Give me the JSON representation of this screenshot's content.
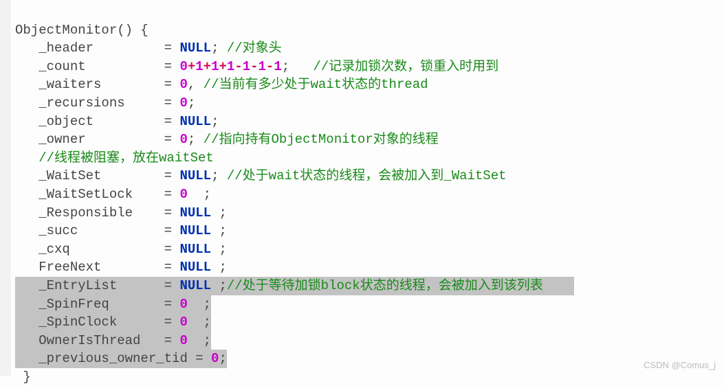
{
  "code": {
    "fn_decl": "ObjectMonitor() {",
    "header_lhs": "   _header         = ",
    "header_null": "NULL",
    "header_semi": "; ",
    "header_cmt": "//对象头",
    "count_lhs": "   _count          = ",
    "count_n0": "0",
    "count_p1": "+",
    "count_n1": "1",
    "count_p2": "+",
    "count_n2": "1",
    "count_p3": "+",
    "count_n3": "1",
    "count_m1": "-",
    "count_n4": "1",
    "count_m2": "-",
    "count_n5": "1",
    "count_m3": "-",
    "count_n6": "1",
    "count_semi": ";   ",
    "count_cmt": "//记录加锁次数，锁重入时用到",
    "waiters_lhs": "   _waiters        = ",
    "waiters_n": "0",
    "waiters_comma": ", ",
    "waiters_cmt": "//当前有多少处于wait状态的thread",
    "recursions_lhs": "   _recursions     = ",
    "recursions_n": "0",
    "recursions_semi": ";",
    "object_lhs": "   _object         = ",
    "object_null": "NULL",
    "object_semi": ";",
    "owner_lhs": "   _owner          = ",
    "owner_n": "0",
    "owner_semi": "; ",
    "owner_cmt": "//指向持有ObjectMonitor对象的线程",
    "block_cmt": "   //线程被阻塞，放在waitSet",
    "waitset_lhs": "   _WaitSet        = ",
    "waitset_null": "NULL",
    "waitset_semi": "; ",
    "waitset_cmt": "//处于wait状态的线程，会被加入到_WaitSet",
    "wslock_lhs": "   _WaitSetLock    = ",
    "wslock_n": "0",
    "wslock_semi": "  ;",
    "responsible_lhs": "   _Responsible    = ",
    "responsible_null": "NULL",
    "responsible_semi": " ;",
    "succ_lhs": "   _succ           = ",
    "succ_null": "NULL",
    "succ_semi": " ;",
    "cxq_lhs": "   _cxq            = ",
    "cxq_null": "NULL",
    "cxq_semi": " ;",
    "freenext_lhs": "   FreeNext        = ",
    "freenext_null": "NULL",
    "freenext_semi": " ;",
    "entrylist_lhs": "   _EntryList      = ",
    "entrylist_null": "NULL",
    "entrylist_semi": " ;",
    "entrylist_cmt": "//处于等待加锁block状态的线程，会被加入到该列表",
    "entrylist_pad": "    ",
    "spinfreq_lhs": "   _SpinFreq       = ",
    "spinfreq_n": "0",
    "spinfreq_semi": "  ;",
    "spinclock_lhs": "   _SpinClock      = ",
    "spinclock_n": "0",
    "spinclock_semi": "  ;",
    "ownerthread_lhs": "   OwnerIsThread   = ",
    "ownerthread_n": "0",
    "ownerthread_semi": "  ;",
    "prevtid_lhs": "   _previous_owner_tid = ",
    "prevtid_n": "0",
    "prevtid_semi": ";",
    "close_brace": " }"
  },
  "watermark": "CSDN @Comus_j"
}
